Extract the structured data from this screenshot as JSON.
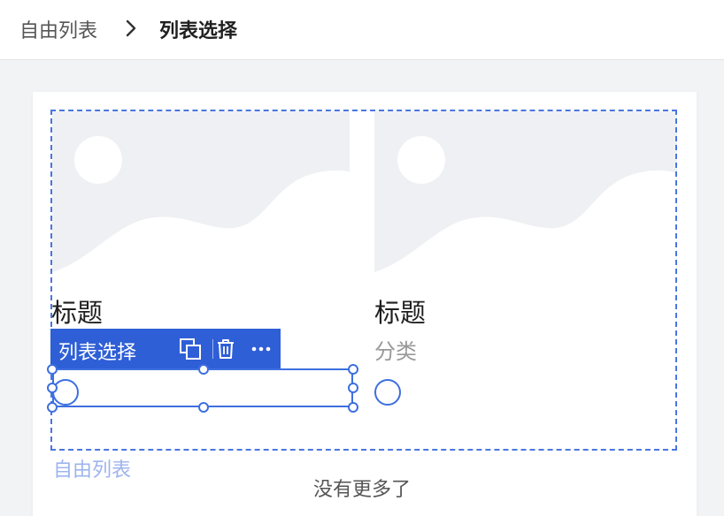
{
  "breadcrumb": {
    "root": "自由列表",
    "current": "列表选择"
  },
  "items": [
    {
      "title": "标题"
    },
    {
      "title": "标题",
      "category": "分类"
    }
  ],
  "toolbar": {
    "label": "列表选择"
  },
  "free_list_label": "自由列表",
  "footer_text": "没有更多了",
  "colors": {
    "accent": "#2f5fd6",
    "placeholder_bg": "#eff0f3"
  },
  "icons": [
    "chevron-right-icon",
    "image-placeholder-icon",
    "copy-icon",
    "trash-icon",
    "more-icon"
  ]
}
